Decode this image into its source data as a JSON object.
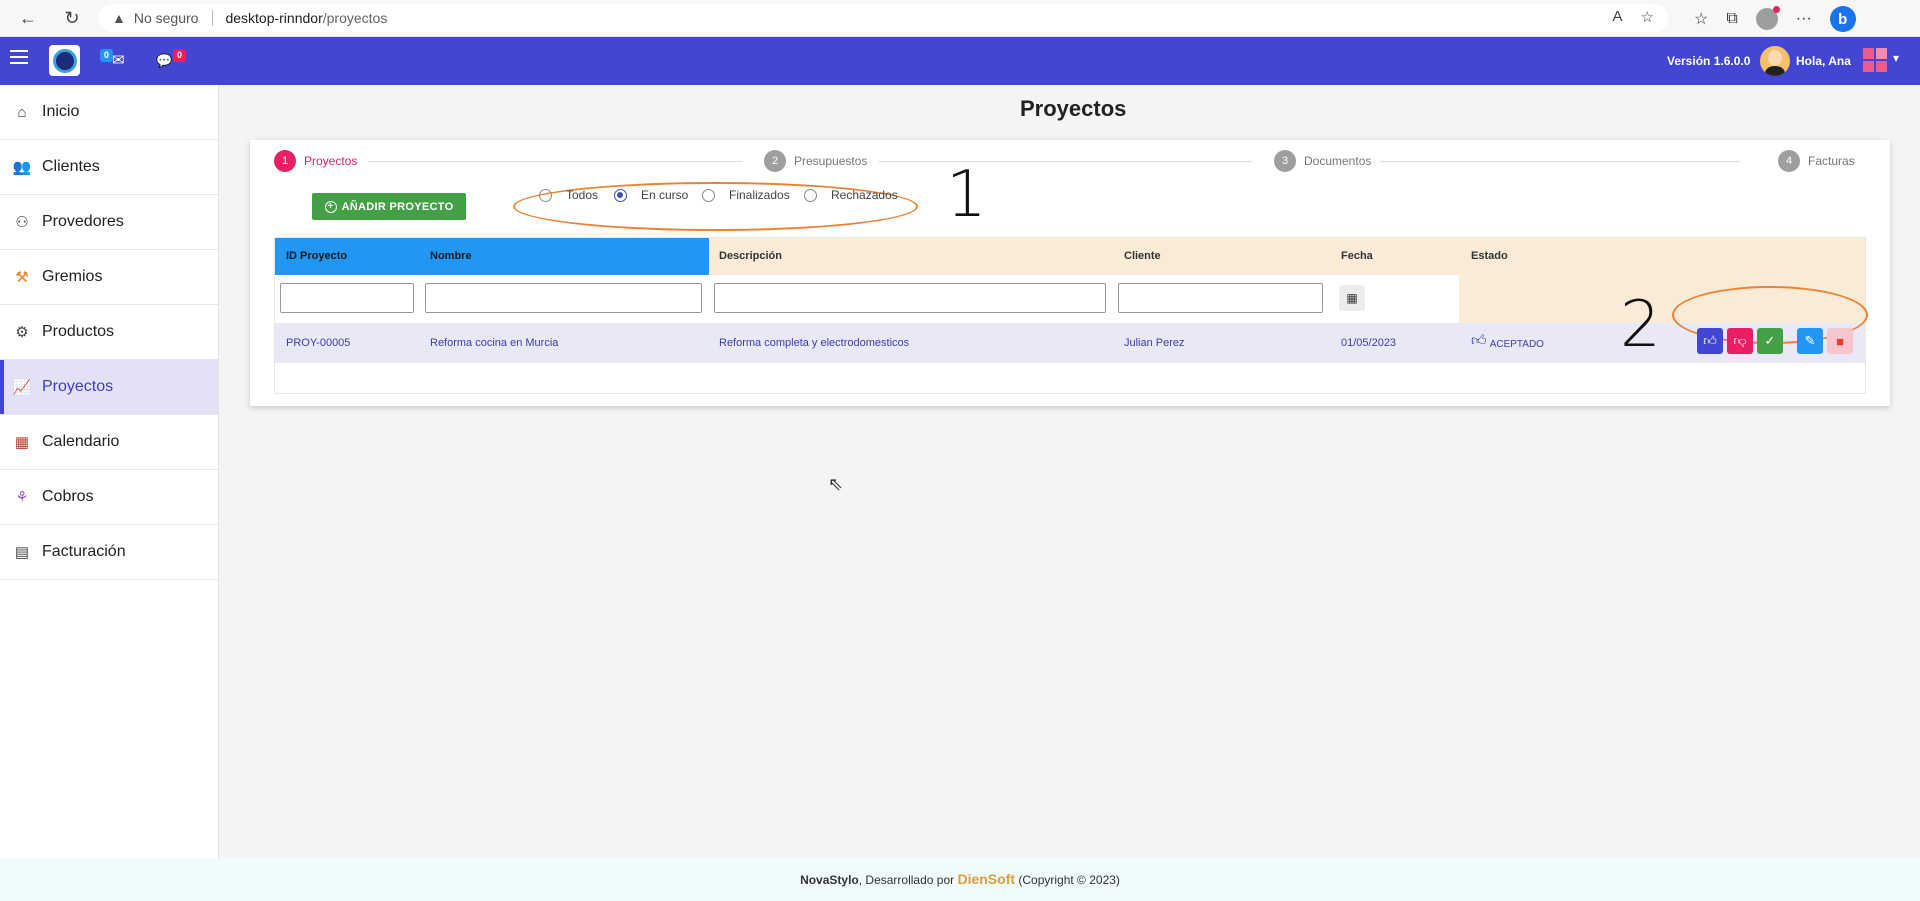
{
  "browser": {
    "security_label": "No seguro",
    "url_host": "desktop-rinndor",
    "url_path": "/proyectos"
  },
  "header": {
    "mail_count": "0",
    "chat_count": "0",
    "version": "Versión 1.6.0.0",
    "greeting": "Hola, Ana"
  },
  "sidebar": {
    "items": [
      {
        "label": "Inicio",
        "icon": "home-icon"
      },
      {
        "label": "Clientes",
        "icon": "clients-icon"
      },
      {
        "label": "Provedores",
        "icon": "suppliers-icon"
      },
      {
        "label": "Gremios",
        "icon": "guilds-icon"
      },
      {
        "label": "Productos",
        "icon": "products-icon"
      },
      {
        "label": "Proyectos",
        "icon": "projects-icon"
      },
      {
        "label": "Calendario",
        "icon": "calendar-icon"
      },
      {
        "label": "Cobros",
        "icon": "payments-icon"
      },
      {
        "label": "Facturación",
        "icon": "invoice-icon"
      }
    ],
    "active_index": 5
  },
  "main": {
    "title": "Proyectos",
    "steps": [
      {
        "num": "1",
        "label": "Proyectos",
        "active": true
      },
      {
        "num": "2",
        "label": "Presupuestos"
      },
      {
        "num": "3",
        "label": "Documentos"
      },
      {
        "num": "4",
        "label": "Facturas"
      }
    ],
    "add_button": "AÑADIR PROYECTO",
    "filters": {
      "options": [
        "Todos",
        "En curso",
        "Finalizados",
        "Rechazados"
      ],
      "selected": "En curso"
    },
    "annotations": [
      "1",
      "2"
    ],
    "table": {
      "columns": [
        "ID Proyecto",
        "Nombre",
        "Descripción",
        "Cliente",
        "Fecha",
        "Estado"
      ],
      "rows": [
        {
          "id": "PROY-00005",
          "nombre": "Reforma cocina en Murcia",
          "descripcion": "Reforma completa y electrodomesticos",
          "cliente": "Julian Perez",
          "fecha": "01/05/2023",
          "estado": "ACEPTADO"
        }
      ]
    }
  },
  "footer": {
    "brand": "NovaStylo",
    "text1": ", Desarrollado por ",
    "developer": "DienSoft",
    "text2": " (Copyright © 2023)"
  },
  "colors": {
    "header_bg": "#4346d3",
    "accent_pink": "#e91e63",
    "add_green": "#43a047",
    "annotation_orange": "#f08030"
  }
}
